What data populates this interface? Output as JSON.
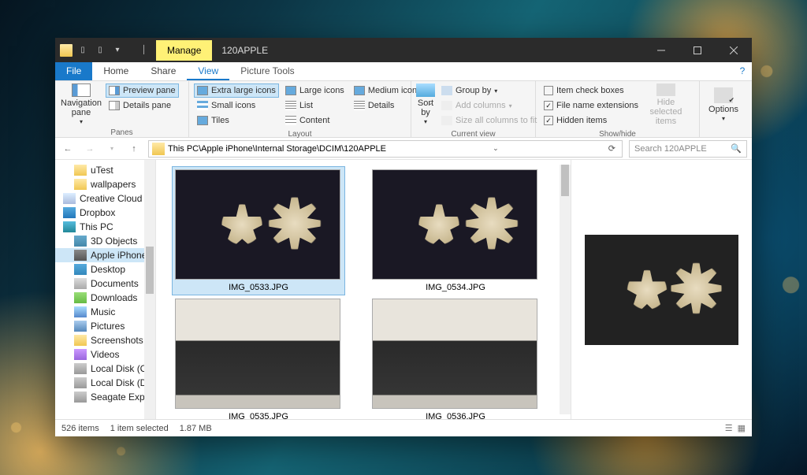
{
  "titlebar": {
    "contextual_tab": "Manage",
    "title": "120APPLE"
  },
  "menu": {
    "file": "File",
    "home": "Home",
    "share": "Share",
    "view": "View",
    "picture_tools": "Picture Tools"
  },
  "ribbon": {
    "panes": {
      "nav": "Navigation pane",
      "preview": "Preview pane",
      "details": "Details pane",
      "group": "Panes"
    },
    "layout": {
      "xl": "Extra large icons",
      "large": "Large icons",
      "medium": "Medium icons",
      "small": "Small icons",
      "list": "List",
      "details": "Details",
      "tiles": "Tiles",
      "content": "Content",
      "group": "Layout"
    },
    "current": {
      "sort": "Sort by",
      "groupby": "Group by",
      "addcols": "Add columns",
      "sizeall": "Size all columns to fit",
      "group": "Current view"
    },
    "showhide": {
      "checkboxes": "Item check boxes",
      "ext": "File name extensions",
      "hidden": "Hidden items",
      "hide": "Hide selected items",
      "group": "Show/hide"
    },
    "options": "Options"
  },
  "address": {
    "path": "This PC\\Apple iPhone\\Internal Storage\\DCIM\\120APPLE",
    "search_placeholder": "Search 120APPLE"
  },
  "tree": {
    "items": [
      {
        "label": "uTest",
        "icon": "ico-folder",
        "lvl": 1
      },
      {
        "label": "wallpapers",
        "icon": "ico-folder",
        "lvl": 1
      },
      {
        "label": "Creative Cloud Files",
        "icon": "ico-cloud",
        "lvl": 0
      },
      {
        "label": "Dropbox",
        "icon": "ico-dbx",
        "lvl": 0
      },
      {
        "label": "This PC",
        "icon": "ico-pc",
        "lvl": 0
      },
      {
        "label": "3D Objects",
        "icon": "ico-3d",
        "lvl": 1
      },
      {
        "label": "Apple iPhone",
        "icon": "ico-phone",
        "lvl": 1,
        "sel": true
      },
      {
        "label": "Desktop",
        "icon": "ico-desk",
        "lvl": 1
      },
      {
        "label": "Documents",
        "icon": "ico-doc",
        "lvl": 1
      },
      {
        "label": "Downloads",
        "icon": "ico-dl",
        "lvl": 1
      },
      {
        "label": "Music",
        "icon": "ico-music",
        "lvl": 1
      },
      {
        "label": "Pictures",
        "icon": "ico-pic",
        "lvl": 1
      },
      {
        "label": "Screenshots",
        "icon": "ico-folder",
        "lvl": 1
      },
      {
        "label": "Videos",
        "icon": "ico-vid",
        "lvl": 1
      },
      {
        "label": "Local Disk (C:)",
        "icon": "ico-disk",
        "lvl": 1
      },
      {
        "label": "Local Disk (D:)",
        "icon": "ico-disk",
        "lvl": 1
      },
      {
        "label": "Seagate Expansion Drive",
        "icon": "ico-disk",
        "lvl": 1
      }
    ]
  },
  "files": [
    {
      "name": "IMG_0533.JPG",
      "kind": "star",
      "sel": true
    },
    {
      "name": "IMG_0534.JPG",
      "kind": "star"
    },
    {
      "name": "IMG_0535.JPG",
      "kind": "kb"
    },
    {
      "name": "IMG_0536.JPG",
      "kind": "kb"
    }
  ],
  "status": {
    "count": "526 items",
    "selection": "1 item selected",
    "size": "1.87 MB"
  }
}
